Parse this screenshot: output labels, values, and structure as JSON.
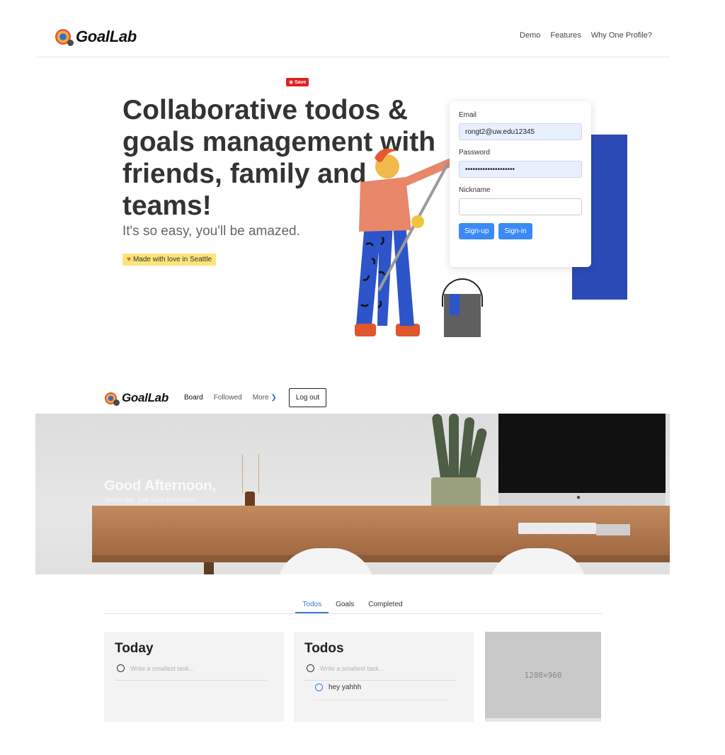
{
  "landing": {
    "brand": "GoalLab",
    "nav": [
      "Demo",
      "Features",
      "Why One Profile?"
    ],
    "save_badge": "Save",
    "hero_title": "Collaborative todos & goals management with friends, family and teams!",
    "hero_subtitle": "It's so easy, you'll be amazed.",
    "love_badge": "Made with love in Seattle",
    "form": {
      "email_label": "Email",
      "email_value": "rongt2@uw.edu12345",
      "password_label": "Password",
      "password_value": "••••••••••••••••••••",
      "nickname_label": "Nickname",
      "nickname_value": "",
      "signup_label": "Sign-up",
      "signin_label": "Sign-in"
    }
  },
  "app": {
    "brand": "GoalLab",
    "nav": {
      "board": "Board",
      "followed": "Followed",
      "more": "More",
      "logout": "Log out"
    },
    "banner": {
      "greeting": "Good Afternoon,",
      "subtext": "Yesterday you said tomorrow..."
    },
    "tabs": [
      {
        "label": "Todos",
        "active": true
      },
      {
        "label": "Goals",
        "active": false
      },
      {
        "label": "Completed",
        "active": false
      }
    ],
    "columns": {
      "today": {
        "title": "Today",
        "input_placeholder": "Write a smallest task..."
      },
      "todos": {
        "title": "Todos",
        "input_placeholder": "Write a smallest task...",
        "items": [
          "hey yahhh"
        ]
      }
    },
    "placeholder_image_label": "1280×960"
  },
  "colors": {
    "accent_blue": "#3a8bf5",
    "block_blue": "#2b4ab5",
    "save_red": "#e02020",
    "badge_yellow": "#fde47a"
  }
}
